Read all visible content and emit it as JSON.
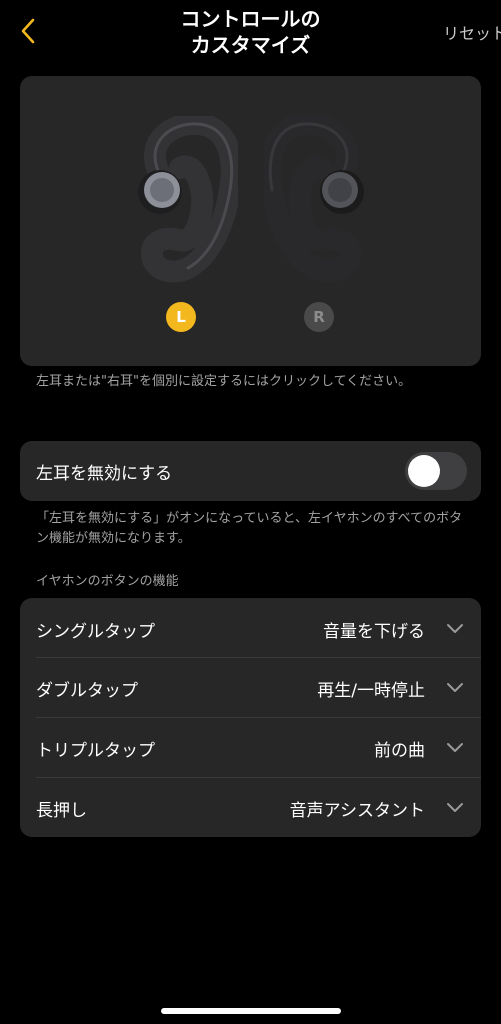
{
  "header": {
    "title_line1": "コントロールの",
    "title_line2": "カスタマイズ",
    "reset_label": "リセット",
    "back_icon": "chevron-left-icon",
    "accent_color": "#f3b81d"
  },
  "preview": {
    "left_badge": "L",
    "right_badge": "R",
    "selected": "L",
    "hint": "左耳または\"右耳\"を個別に設定するにはクリックしてください。"
  },
  "disable_left": {
    "label": "左耳を無効にする",
    "enabled": false,
    "hint": "「左耳を無効にする」がオンになっていると、左イヤホンのすべてのボタン機能が無効になります。"
  },
  "button_functions": {
    "header": "イヤホンのボタンの機能",
    "items": [
      {
        "label": "シングルタップ",
        "value": "音量を下げる"
      },
      {
        "label": "ダブルタップ",
        "value": "再生/一時停止"
      },
      {
        "label": "トリプルタップ",
        "value": "前の曲"
      },
      {
        "label": "長押し",
        "value": "音声アシスタント"
      }
    ]
  }
}
